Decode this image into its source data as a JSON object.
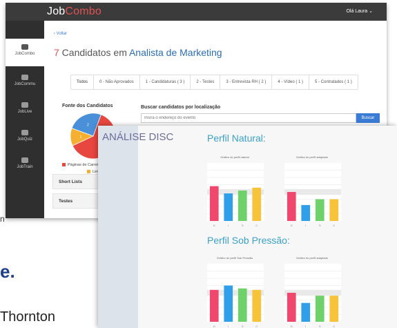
{
  "app": {
    "logo_prefix": "Job",
    "logo_accent": "Combo",
    "user_menu": "Olá Laura ⌄",
    "sidebar": [
      {
        "label": "JobCombo",
        "active": true
      },
      {
        "label": "JobCommu",
        "active": false
      },
      {
        "label": "JobLive",
        "active": false
      },
      {
        "label": "JobQuiz",
        "active": false
      },
      {
        "label": "JobTrain",
        "active": false
      }
    ],
    "back_link": "‹ Voltar",
    "title_count": "7",
    "title_middle": " Candidatos em ",
    "title_role": "Analista de Marketing",
    "tabs": [
      "Todos",
      "0 - Não Aprovados",
      "1 - Candidaturas ( 3 )",
      "2 - Testes",
      "3 - Entrevista RH ( 2 )",
      "4 - Vídeo ( 1 )",
      "5 - Contratados ( 1 )"
    ],
    "source_title": "Fonte dos Candidatos",
    "pie": {
      "slices": [
        {
          "label": "Páginas de Carreira",
          "value": 5,
          "color": "#e8473f"
        },
        {
          "label": "Linkedin",
          "value": 1,
          "color": "#f5b031"
        },
        {
          "label": "",
          "value": 2,
          "color": "#4a90d9"
        }
      ],
      "slice_labels": [
        "5",
        "1",
        "2"
      ]
    },
    "search_label": "Buscar candidatos por localização",
    "search_placeholder": "Insira o endereço do evento",
    "search_button": "Buscar",
    "accordions": [
      "Short Lists",
      "Testes"
    ]
  },
  "background": {
    "logo_n": "n",
    "logo_e": "e.",
    "logo_thornton": "Thornton"
  },
  "disc": {
    "title": "ANÁLISE DISC",
    "perfil_natural": "Perfil Natural:",
    "perfil_pressao": "Perfil Sob Pressão:",
    "chart_caption_a": "Gráfico do perfil natural",
    "chart_caption_b": "Gráfico do perfil adaptado",
    "chart_caption_c": "Gráfico do perfil Sob Pressão",
    "chart_caption_d": "Gráfico do perfil adaptado",
    "colors": [
      "#f0476e",
      "#2e9fe8",
      "#6fd16a",
      "#f6c33b"
    ]
  },
  "chart_data": [
    {
      "type": "bar",
      "title": "Gráfico do perfil natural",
      "categories": [
        "D",
        "I",
        "S",
        "C"
      ],
      "values": [
        48,
        38,
        42,
        46
      ],
      "ylim": [
        0,
        80
      ]
    },
    {
      "type": "bar",
      "title": "Gráfico do perfil adaptado",
      "categories": [
        "D",
        "I",
        "S",
        "C"
      ],
      "values": [
        40,
        22,
        30,
        30
      ],
      "ylim": [
        0,
        80
      ]
    },
    {
      "type": "bar",
      "title": "Gráfico do perfil Sob Pressão",
      "categories": [
        "D",
        "I",
        "S",
        "C"
      ],
      "values": [
        44,
        50,
        46,
        44
      ],
      "ylim": [
        0,
        80
      ]
    },
    {
      "type": "bar",
      "title": "Gráfico do perfil adaptado",
      "categories": [
        "D",
        "I",
        "S",
        "C"
      ],
      "values": [
        40,
        26,
        36,
        36
      ],
      "ylim": [
        0,
        80
      ]
    }
  ]
}
